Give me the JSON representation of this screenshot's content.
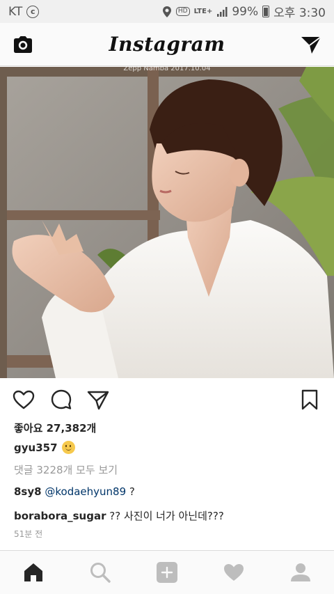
{
  "status_bar": {
    "carrier": "KT",
    "carrier_symbol": "c",
    "hd_label": "HD",
    "network": "LTE+",
    "battery": "99%",
    "time": "오후 3:30"
  },
  "header": {
    "title": "Instagram",
    "camera_icon": "camera-icon",
    "direct_icon": "paper-plane-icon"
  },
  "post": {
    "photo_caption": "Zepp Namba 2017.10.04",
    "likes": "좋아요 27,382개",
    "author": "gyu357",
    "view_comments": "댓글 3228개 모두 보기",
    "comments": [
      {
        "user": "8sy8",
        "mention": "@kodaehyun89",
        "text": "?"
      },
      {
        "user": "borabora_sugar",
        "text": "?? 사진이 너가 아닌데???"
      }
    ],
    "time_ago": "51분 전"
  },
  "actions": {
    "like_icon": "heart-outline-icon",
    "comment_icon": "comment-bubble-icon",
    "share_icon": "paper-plane-icon",
    "save_icon": "bookmark-icon"
  },
  "bottom_nav": {
    "items": [
      "home-icon",
      "search-icon",
      "add-post-icon",
      "activity-heart-icon",
      "profile-icon"
    ],
    "active": "home-icon"
  },
  "colors": {
    "text": "#262626",
    "secondary_text": "#999999",
    "mention": "#003569",
    "nav_inactive": "#bdbdbd",
    "header_bg": "#fafafa",
    "status_bar_bg": "#f0f0f0"
  }
}
